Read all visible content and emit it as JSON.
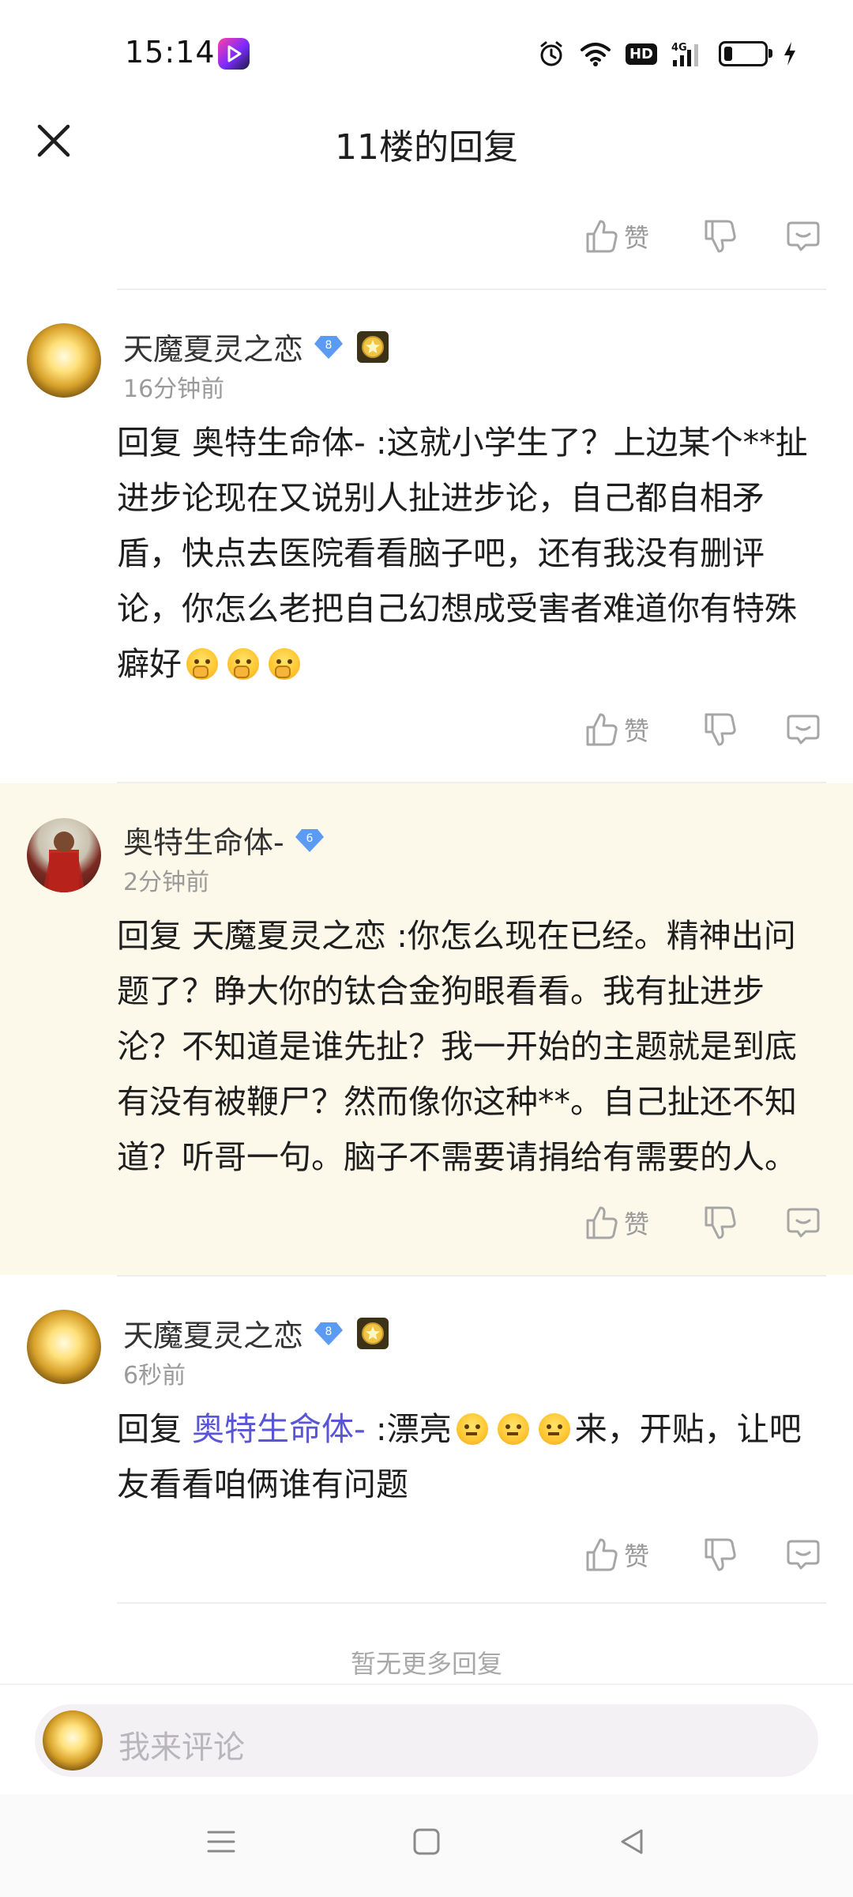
{
  "status_bar": {
    "time": "15:14",
    "hd_label": "HD",
    "network": "4G"
  },
  "header": {
    "title": "11楼的回复"
  },
  "actions": {
    "like_label": "赞"
  },
  "comments": [
    {
      "username": "天魔夏灵之恋",
      "level": "8",
      "time": "16分钟前",
      "text": "回复 奥特生命体- :这就小学生了？上边某个**扯进步论现在又说别人扯进步论，自己都自相矛盾，快点去医院看看脑子吧，还有我没有删评论，你怎么老把自己幻想成受害者难道你有特殊癖好"
    },
    {
      "username": "奥特生命体-",
      "level": "6",
      "time": "2分钟前",
      "text": "回复 天魔夏灵之恋 :你怎么现在已经。精神出问题了？睁大你的钛合金狗眼看看。我有扯进步沦？不知道是谁先扯？我一开始的主题就是到底有没有被鞭尸？然而像你这种**。自己扯还不知道？听哥一句。脑子不需要请捐给有需要的人。"
    },
    {
      "username": "天魔夏灵之恋",
      "level": "8",
      "time": "6秒前",
      "reply_prefix": "回复 ",
      "reply_target": "奥特生命体-",
      "text_a": " :漂亮",
      "text_b": "来，开贴，让吧友看看咱俩谁有问题"
    }
  ],
  "footer": {
    "no_more": "暂无更多回复"
  },
  "composer": {
    "placeholder": "我来评论"
  },
  "colors": {
    "link": "#5a55d6",
    "highlight_bg": "#fdf9ea",
    "level_badge": "#5b9cf2"
  }
}
